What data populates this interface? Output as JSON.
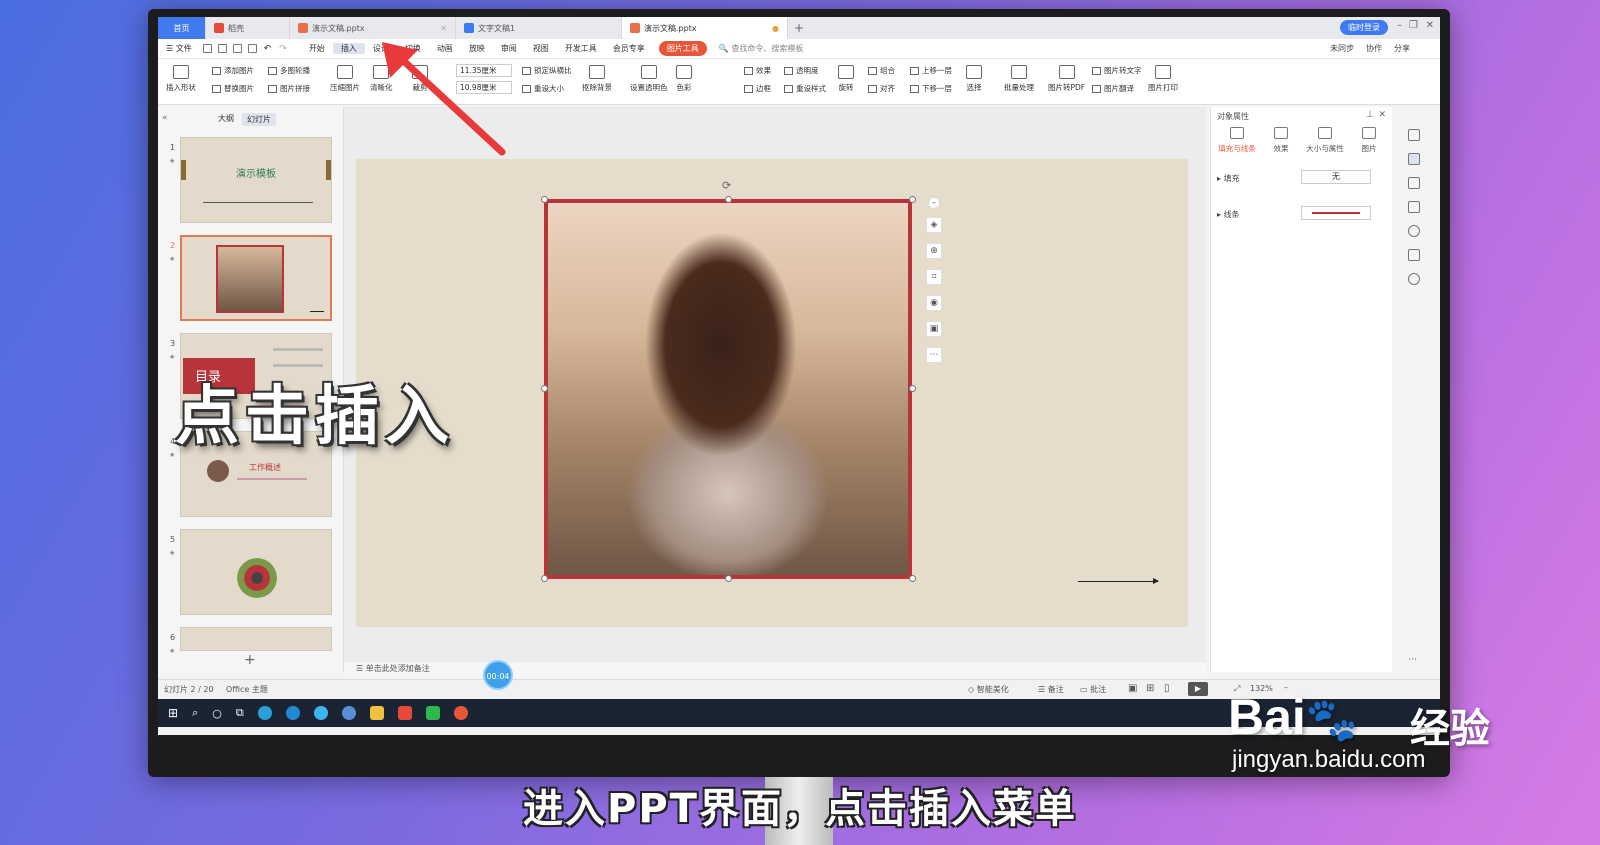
{
  "titlebar": {
    "tabs": [
      {
        "label": "首页",
        "type": "home"
      },
      {
        "label": "稻壳",
        "color": "#e84a3a"
      },
      {
        "label": "演示文稿.pptx",
        "color": "#e8704a"
      },
      {
        "label": "文字文稿1",
        "color": "#3f7af0"
      },
      {
        "label": "演示文稿.pptx",
        "color": "#e8704a",
        "active": true
      }
    ],
    "login": "临时登录"
  },
  "menubar": {
    "file": "文件",
    "items": [
      "开始",
      "插入",
      "设计",
      "切换",
      "动画",
      "放映",
      "审阅",
      "视图",
      "开发工具",
      "会员专享"
    ],
    "tool_tab": "图片工具",
    "search": "查找命令、搜索模板",
    "right": [
      "未同步",
      "协作",
      "分享"
    ]
  },
  "ribbon": {
    "big": [
      "插入形状",
      "压缩图片",
      "清晰化",
      "裁剪",
      "抠除背景",
      "设置透明色",
      "色彩",
      "旋转",
      "选择",
      "批量处理",
      "图片转PDF",
      "图片打印"
    ],
    "small": [
      "添加图片",
      "替换图片",
      "多图轮播",
      "图片拼接",
      "锁定纵横比",
      "重设大小",
      "效果",
      "边框",
      "透明度",
      "重设样式",
      "组合",
      "对齐",
      "上移一层",
      "下移一层",
      "图片转文字",
      "图片翻译"
    ],
    "width": "11.35厘米",
    "height": "10.98厘米"
  },
  "slides_panel": {
    "tabs": [
      "大纲",
      "幻灯片"
    ],
    "thumbs": [
      {
        "num": "1",
        "text": "演示模板"
      },
      {
        "num": "2",
        "text": ""
      },
      {
        "num": "3",
        "text": "目录"
      },
      {
        "num": "4",
        "text": "工作概述"
      },
      {
        "num": "5",
        "text": ""
      },
      {
        "num": "6",
        "text": ""
      }
    ]
  },
  "notes": "单击此处添加备注",
  "right_panel": {
    "title": "对象属性",
    "tabs": [
      "填充与线条",
      "效果",
      "大小与属性",
      "图片"
    ],
    "fill_label": "填充",
    "fill_value": "无",
    "line_label": "线条"
  },
  "statusbar": {
    "slide_info": "幻灯片 2 / 20",
    "theme": "Office 主题",
    "beautify": "智能美化",
    "notes": "备注",
    "comment": "批注",
    "zoom": "132%"
  },
  "timer": "00:04",
  "overlay": {
    "big_caption": "点击插入",
    "subtitle": "进入PPT界面，点击插入菜单",
    "brand": "Bai",
    "brand_cn": "经验",
    "brand_url": "jingyan.baidu.com"
  }
}
